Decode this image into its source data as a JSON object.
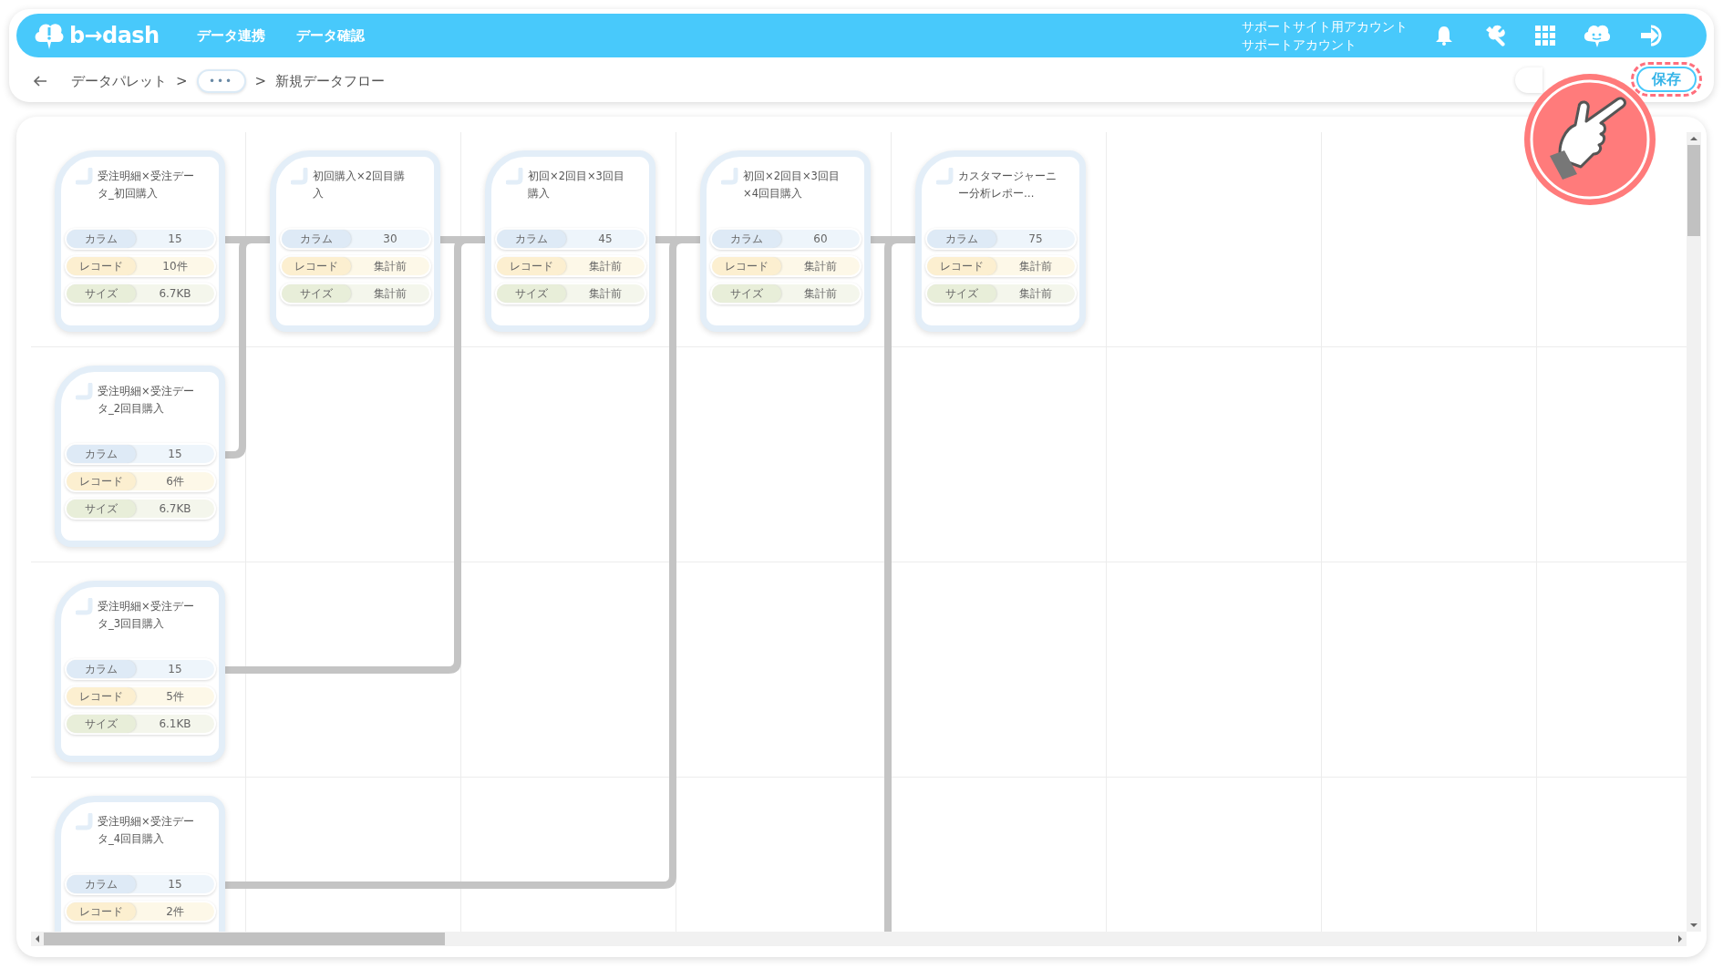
{
  "header": {
    "logo_text": "b→dash",
    "nav": [
      "データ連携",
      "データ確認"
    ],
    "account": [
      "サポートサイト用アカウント",
      "サポートアカウント"
    ]
  },
  "breadcrumb": [
    {
      "kind": "link",
      "text": "データパレット"
    },
    {
      "kind": "sep",
      "text": ">"
    },
    {
      "kind": "more",
      "text": "•••"
    },
    {
      "kind": "sep",
      "text": ">"
    },
    {
      "kind": "current",
      "text": "新規データフロー"
    }
  ],
  "save_button": {
    "label": "保存",
    "highlighted": true
  },
  "source_nodes": [
    {
      "title": "受注明細×受注データ_初回購入",
      "stats": [
        {
          "kind": "column",
          "label": "カラム",
          "value": "15"
        },
        {
          "kind": "record",
          "label": "レコード",
          "value": "10件"
        },
        {
          "kind": "size",
          "label": "サイズ",
          "value": "6.7KB"
        }
      ]
    },
    {
      "title": "受注明細×受注データ_2回目購入",
      "stats": [
        {
          "kind": "column",
          "label": "カラム",
          "value": "15"
        },
        {
          "kind": "record",
          "label": "レコード",
          "value": "6件"
        },
        {
          "kind": "size",
          "label": "サイズ",
          "value": "6.7KB"
        }
      ]
    },
    {
      "title": "受注明細×受注データ_3回目購入",
      "stats": [
        {
          "kind": "column",
          "label": "カラム",
          "value": "15"
        },
        {
          "kind": "record",
          "label": "レコード",
          "value": "5件"
        },
        {
          "kind": "size",
          "label": "サイズ",
          "value": "6.1KB"
        }
      ]
    },
    {
      "title": "受注明細×受注データ_4回目購入",
      "stats": [
        {
          "kind": "column",
          "label": "カラム",
          "value": "15"
        },
        {
          "kind": "record",
          "label": "レコード",
          "value": "2件"
        }
      ]
    }
  ],
  "joined_nodes": [
    {
      "title": "初回購入×2回目購入",
      "stats": [
        {
          "kind": "column",
          "label": "カラム",
          "value": "30"
        },
        {
          "kind": "record",
          "label": "レコード",
          "value": "集計前"
        },
        {
          "kind": "size",
          "label": "サイズ",
          "value": "集計前"
        }
      ]
    },
    {
      "title": "初回×2回目×3回目購入",
      "stats": [
        {
          "kind": "column",
          "label": "カラム",
          "value": "45"
        },
        {
          "kind": "record",
          "label": "レコード",
          "value": "集計前"
        },
        {
          "kind": "size",
          "label": "サイズ",
          "value": "集計前"
        }
      ]
    },
    {
      "title": "初回×2回目×3回目×4回目購入",
      "stats": [
        {
          "kind": "column",
          "label": "カラム",
          "value": "60"
        },
        {
          "kind": "record",
          "label": "レコード",
          "value": "集計前"
        },
        {
          "kind": "size",
          "label": "サイズ",
          "value": "集計前"
        }
      ]
    },
    {
      "title": "カスタマージャーニー分析レポー…",
      "stats": [
        {
          "kind": "column",
          "label": "カラム",
          "value": "75"
        },
        {
          "kind": "record",
          "label": "レコード",
          "value": "集計前"
        },
        {
          "kind": "size",
          "label": "サイズ",
          "value": "集計前"
        }
      ]
    }
  ]
}
